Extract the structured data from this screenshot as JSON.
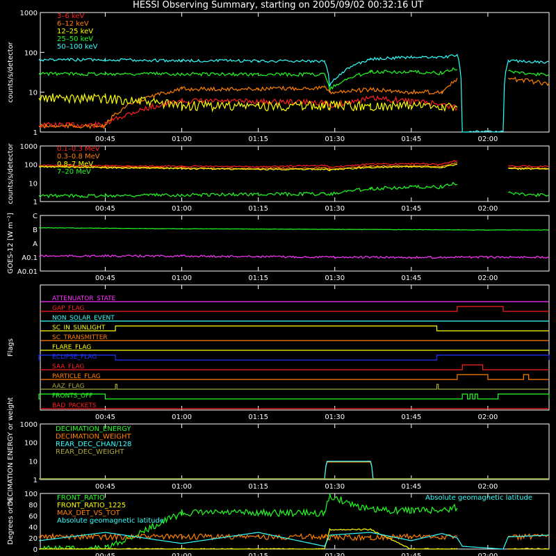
{
  "title": "HESSI Observing Summary, starting on 2005/09/02 00:32:16 UT",
  "time_ticks": [
    "00:45",
    "01:00",
    "01:15",
    "01:30",
    "01:45",
    "02:00"
  ],
  "colors": {
    "red": "#ff2020",
    "orange": "#ff7f00",
    "yellow": "#ffff00",
    "green": "#22ff22",
    "cyan": "#33ffff",
    "magenta": "#ff33ff",
    "blue": "#2233ff",
    "olive": "#a8a83a"
  },
  "chart_data": [
    {
      "type": "line",
      "ylabel": "counts/s/detector",
      "yscale": "log",
      "ylim": [
        1,
        1000
      ],
      "y_ticks": [
        "1",
        "10",
        "100",
        "1000"
      ],
      "x": [
        "00:32",
        "00:45",
        "01:00",
        "01:15",
        "01:28",
        "01:29",
        "01:37",
        "01:45",
        "01:51",
        "01:54",
        "01:55",
        "02:03",
        "02:04",
        "02:12"
      ],
      "series": [
        {
          "name": "3–6 keV",
          "color": "red",
          "values": [
            1.5,
            1.5,
            6,
            5.8,
            5.6,
            4.5,
            7,
            6,
            5,
            4,
            null,
            null,
            null,
            null
          ]
        },
        {
          "name": "6–12 keV",
          "color": "orange",
          "values": [
            1.4,
            1.4,
            12,
            12,
            13,
            10,
            11.5,
            10,
            10,
            20,
            null,
            null,
            22,
            16
          ]
        },
        {
          "name": "12–25 keV",
          "color": "yellow",
          "values": [
            7,
            7,
            4.5,
            4.5,
            4.5,
            4.5,
            4.5,
            4.5,
            4.5,
            4,
            null,
            null,
            null,
            null
          ]
        },
        {
          "name": "25–50 keV",
          "color": "green",
          "values": [
            29,
            29,
            29,
            28,
            28,
            12,
            33,
            32,
            30,
            40,
            null,
            null,
            34,
            26
          ]
        },
        {
          "name": "50–100 keV",
          "color": "cyan",
          "values": [
            65,
            65,
            62,
            61,
            60,
            15,
            68,
            76,
            74,
            85,
            1,
            1,
            62,
            55
          ]
        }
      ]
    },
    {
      "type": "line",
      "ylabel": "counts/s/detector",
      "yscale": "log",
      "ylim": [
        1,
        1000
      ],
      "y_ticks": [
        "1",
        "10",
        "100",
        "1000"
      ],
      "x": [
        "00:32",
        "00:45",
        "01:00",
        "01:15",
        "01:28",
        "01:29",
        "01:37",
        "01:45",
        "01:51",
        "01:54",
        "01:55",
        "02:03",
        "02:04",
        "02:12"
      ],
      "series": [
        {
          "name": "0.1–0.3 MeV",
          "color": "red",
          "values": [
            90,
            85,
            80,
            75,
            90,
            70,
            105,
            110,
            105,
            160,
            null,
            null,
            85,
            78
          ]
        },
        {
          "name": "0.3–0.8 MeV",
          "color": "orange",
          "values": [
            80,
            72,
            65,
            60,
            65,
            55,
            80,
            85,
            80,
            120,
            null,
            null,
            65,
            60
          ]
        },
        {
          "name": "0.8–7 MeV",
          "color": "yellow",
          "values": [
            75,
            68,
            60,
            55,
            55,
            50,
            70,
            75,
            70,
            100,
            null,
            null,
            60,
            55
          ]
        },
        {
          "name": "7–20 MeV",
          "color": "green",
          "values": [
            2,
            2.1,
            2.3,
            2.5,
            2.6,
            2.5,
            5,
            6,
            6,
            10,
            null,
            null,
            3,
            2
          ]
        }
      ]
    },
    {
      "type": "line",
      "ylabel": "GOES-12 [W m⁻²]",
      "yscale": "log",
      "y_ticks": [
        "A0.01",
        "A0.1",
        "A",
        "B",
        "C"
      ],
      "x": [
        "00:32",
        "00:45",
        "01:00",
        "01:15",
        "01:30",
        "01:45",
        "02:00",
        "02:12"
      ],
      "series": [
        {
          "name": "GOES long",
          "color": "green",
          "values": [
            1.3e-07,
            1.2e-07,
            1.1e-07,
            1.05e-07,
            1e-07,
            9.5e-08,
            9e-08,
            9e-08
          ]
        },
        {
          "name": "GOES short",
          "color": "magenta",
          "values": [
            1.2e-09,
            1.2e-09,
            1.2e-09,
            1.1e-09,
            1e-09,
            9.5e-10,
            1e-09,
            1e-09
          ]
        }
      ]
    },
    {
      "type": "line",
      "ylabel": "Flags",
      "flags": [
        {
          "name": "ATTENUATOR_STATE",
          "color": "magenta",
          "on": []
        },
        {
          "name": "GAP_FLAG",
          "color": "red",
          "on": [
            [
              "01:54",
              "02:03"
            ]
          ]
        },
        {
          "name": "NON_SOLAR_EVENT",
          "color": "cyan",
          "on": []
        },
        {
          "name": "SC_IN_SUNLIGHT",
          "color": "yellow",
          "on": [
            [
              "00:47",
              "01:50"
            ]
          ]
        },
        {
          "name": "SC_TRANSMITTER",
          "color": "orange",
          "on": []
        },
        {
          "name": "FLARE_FLAG",
          "color": "yellow",
          "on": []
        },
        {
          "name": "ECLIPSE_FLAG",
          "color": "blue",
          "on": [
            [
              "00:32",
              "00:47"
            ],
            [
              "01:50",
              "02:12"
            ]
          ]
        },
        {
          "name": "SAA_FLAG",
          "color": "red",
          "on": [
            [
              "01:55",
              "01:59"
            ]
          ]
        },
        {
          "name": "PARTICLE_FLAG",
          "color": "orange",
          "on": [
            [
              "01:54",
              "02:00"
            ],
            [
              "02:07",
              "02:08"
            ]
          ]
        },
        {
          "name": "AAZ_FLAG",
          "color": "olive",
          "on": [
            [
              "00:47",
              "00:47.3"
            ],
            [
              "01:50",
              "01:50.3"
            ]
          ]
        },
        {
          "name": "FRONTS_OFF",
          "color": "green",
          "on": [
            [
              "00:32",
              "00:45"
            ],
            [
              "01:55",
              "01:56"
            ],
            [
              "01:56.5",
              "01:57"
            ],
            [
              "01:57.5",
              "01:58"
            ],
            [
              "02:02",
              "02:12"
            ]
          ]
        },
        {
          "name": "BAD_PACKETS",
          "color": "red",
          "on": []
        }
      ]
    },
    {
      "type": "line",
      "ylabel": "DECIMATION ENERGY or weight",
      "yscale": "log",
      "ylim": [
        1,
        1000
      ],
      "y_ticks": [
        "1",
        "10",
        "100",
        "1000"
      ],
      "x": [
        "00:32",
        "01:28",
        "01:28.5",
        "01:37",
        "01:37.5",
        "02:12"
      ],
      "series": [
        {
          "name": "DECIMATION_ENERGY",
          "color": "green",
          "values": [
            1,
            1,
            1,
            1,
            1,
            1
          ]
        },
        {
          "name": "DECIMATION_WEIGHT",
          "color": "orange",
          "values": [
            1,
            1,
            8,
            8,
            1,
            1
          ]
        },
        {
          "name": "REAR_DEC_CHAN/128",
          "color": "cyan",
          "values": [
            1,
            1,
            9,
            9,
            1,
            1
          ]
        },
        {
          "name": "REAR_DEC_WEIGHT",
          "color": "olive",
          "values": [
            1,
            1,
            1,
            1,
            1,
            1
          ]
        }
      ]
    },
    {
      "type": "line",
      "ylabel": "Degrees or %",
      "ylim": [
        0,
        100
      ],
      "y_ticks": [
        "0",
        "20",
        "40",
        "60",
        "80",
        "100"
      ],
      "annotation": "Absolute geomagnetic latitude",
      "x": [
        "00:32",
        "00:45",
        "01:00",
        "01:15",
        "01:28",
        "01:29",
        "01:37",
        "01:45",
        "01:51",
        "01:54",
        "01:55",
        "02:03",
        "02:04",
        "02:12"
      ],
      "series": [
        {
          "name": "FRONT_RATIO",
          "color": "green",
          "values": [
            0,
            0,
            65,
            65,
            65,
            95,
            70,
            70,
            70,
            75,
            null,
            null,
            null,
            null
          ]
        },
        {
          "name": "FRONT_RATIO_1225",
          "color": "yellow",
          "values": [
            0,
            0,
            0,
            0,
            0,
            35,
            35,
            0,
            0,
            0,
            null,
            null,
            0,
            0
          ]
        },
        {
          "name": "MAX_DET_VS_TOT",
          "color": "orange",
          "values": [
            22,
            22,
            22,
            22,
            22,
            20,
            21,
            22,
            22,
            22,
            null,
            null,
            22,
            22
          ]
        },
        {
          "name": "Absolute geomagnetic latitude",
          "color": "cyan",
          "values": [
            15,
            30,
            10,
            30,
            5,
            25,
            30,
            15,
            28,
            20,
            5,
            0,
            22,
            25
          ]
        }
      ]
    }
  ]
}
